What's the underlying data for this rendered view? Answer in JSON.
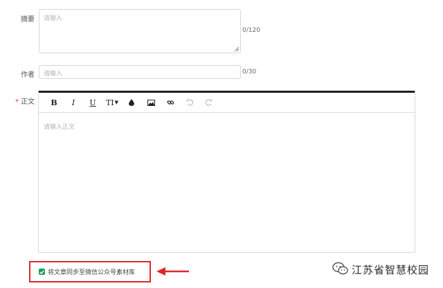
{
  "form": {
    "summary": {
      "label": "摘要",
      "placeholder": "请输入",
      "counter": "0/120"
    },
    "author": {
      "label": "作者",
      "placeholder": "请输入",
      "counter": "0/30"
    },
    "body": {
      "required_mark": "*",
      "label": "正文",
      "placeholder": "请输入正文"
    },
    "toolbar": {
      "bold": "B",
      "italic": "I",
      "underline": "U",
      "font_size": "TI",
      "icons": [
        "bold-icon",
        "italic-icon",
        "underline-icon",
        "font-size-icon",
        "text-color-icon",
        "image-icon",
        "link-icon",
        "undo-icon",
        "redo-icon"
      ]
    },
    "sync_wechat": {
      "checked": true,
      "label": "将文章同步至微信公众号素材库"
    }
  },
  "watermark": {
    "text": "江苏省智慧校园"
  },
  "colors": {
    "highlight": "#e0262b",
    "checkbox": "#18a058",
    "editor_top_border": "#1f1f1f"
  }
}
